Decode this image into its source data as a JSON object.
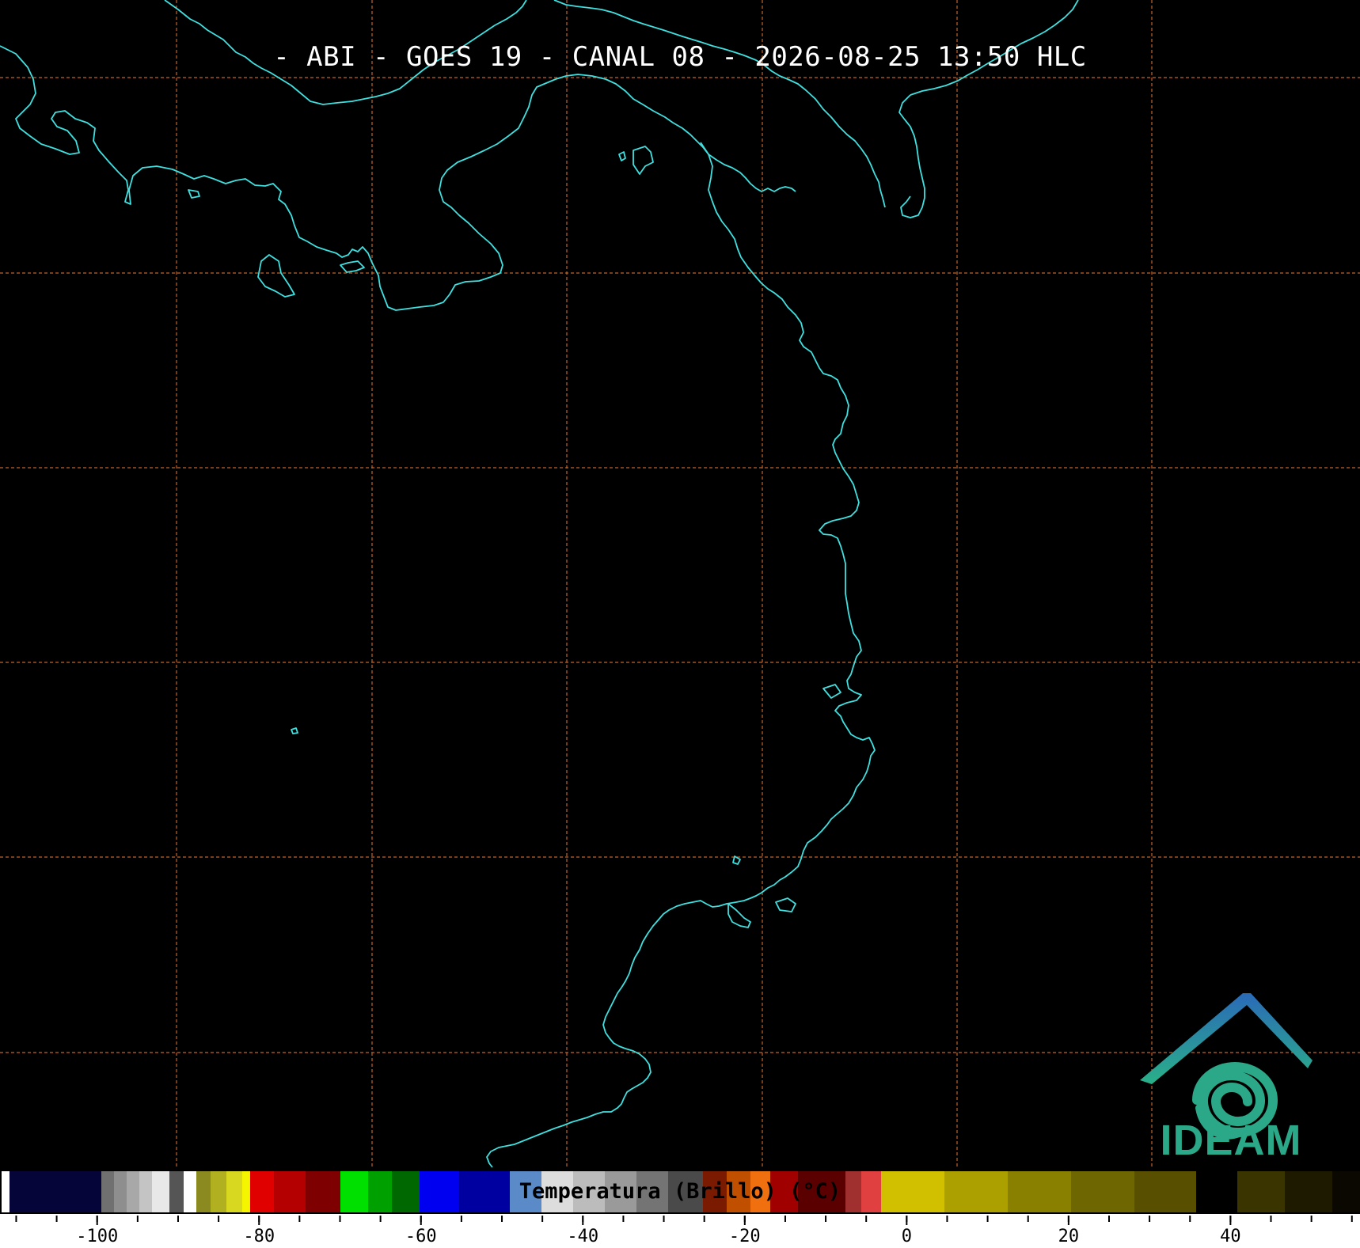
{
  "header": {
    "title": "- ABI - GOES 19 - CANAL 08 - 2026-08-25 13:50 HLC"
  },
  "map": {
    "coastline_color": "#40e0e0",
    "graticule_color": "#c0652a",
    "background_color": "#000000"
  },
  "colorbar": {
    "label": "Temperatura (Brillo) (°C)",
    "ticks": [
      "-100",
      "-80",
      "-60",
      "-40",
      "-20",
      "0",
      "20",
      "40"
    ],
    "range": [
      -112,
      56
    ]
  },
  "logo": {
    "text": "IDEAM",
    "icon": "ideam-spiral-logo"
  }
}
